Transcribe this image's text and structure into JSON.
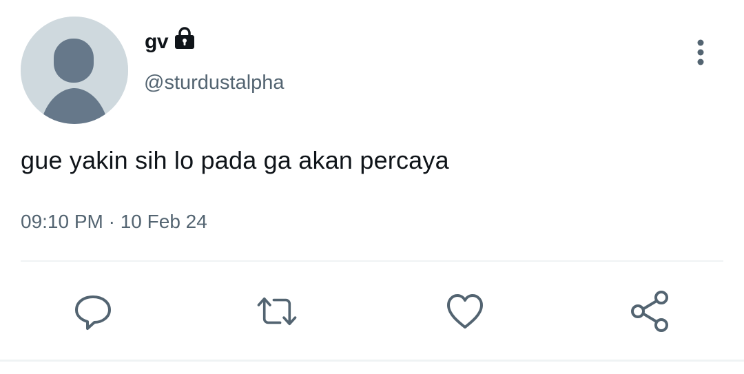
{
  "user": {
    "display_name": "gv",
    "handle": "@sturdustalpha",
    "protected_icon": "lock-icon",
    "avatar_icon": "default-avatar"
  },
  "tweet": {
    "text": "gue yakin sih lo pada ga akan percaya",
    "timestamp": "09:10 PM · 10 Feb 24"
  },
  "actions": [
    {
      "name": "reply",
      "icon": "comment-icon"
    },
    {
      "name": "retweet",
      "icon": "retweet-icon"
    },
    {
      "name": "like",
      "icon": "heart-icon"
    },
    {
      "name": "share",
      "icon": "share-icon"
    }
  ],
  "menu_icon": "more-vertical-icon",
  "colors": {
    "text_primary": "#0f1419",
    "text_secondary": "#536471",
    "icon": "#536471",
    "avatar_bg": "#cfd9de",
    "avatar_fg": "#66788a",
    "divider": "#eff3f4"
  }
}
